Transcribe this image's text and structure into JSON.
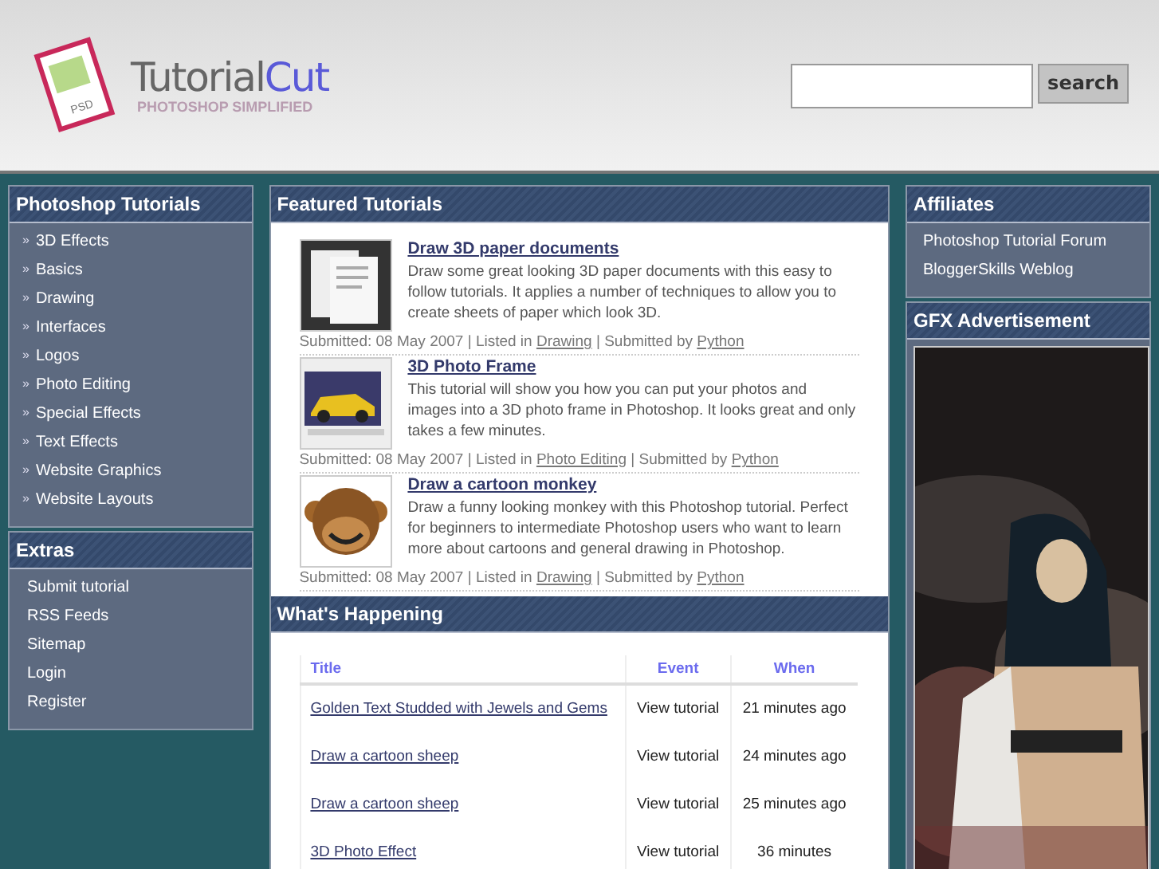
{
  "header": {
    "logo_word_1": "Tutorial",
    "logo_word_2": "Cut",
    "logo_tagline": "PHOTOSHOP SIMPLIFIED",
    "logo_badge": "PSD",
    "search": {
      "button": "search"
    }
  },
  "left": [
    {
      "title": "Photoshop Tutorials",
      "bullet": "»",
      "items": [
        "3D Effects",
        "Basics",
        "Drawing",
        "Interfaces",
        "Logos",
        "Photo Editing",
        "Special Effects",
        "Text Effects",
        "Website Graphics",
        "Website Layouts"
      ]
    },
    {
      "title": "Extras",
      "items": [
        "Submit tutorial",
        "RSS Feeds",
        "Sitemap",
        "Login",
        "Register"
      ]
    }
  ],
  "featured": {
    "title": "Featured Tutorials",
    "items": [
      {
        "kind": "documents",
        "title": "Draw 3D paper documents",
        "description": "Draw some great looking 3D paper documents with this easy to follow tutorials. It applies a number of techniques to allow you to create sheets of paper which look 3D.",
        "submitted": "Submitted: 08 May 2007 | Listed in ",
        "category": "Drawing",
        "by": " | Submitted by ",
        "author": "Python"
      },
      {
        "title": "3D Photo Frame",
        "description": "This tutorial will show you how you can put your photos and images into a 3D photo frame in Photoshop. It looks great and only takes a few minutes.",
        "submitted": "Submitted: 08 May 2007 | Listed in ",
        "category": "Photo Editing",
        "by": " | Submitted by ",
        "author": "Python"
      },
      {
        "kind": "monkey",
        "title": "Draw a cartoon monkey",
        "description": "Draw a funny looking monkey with this Photoshop tutorial. Perfect for beginners to intermediate Photoshop users who want to learn more about cartoons and general drawing in Photoshop.",
        "submitted": "Submitted: 08 May 2007 | Listed in ",
        "category": "Drawing",
        "by": " | Submitted by ",
        "author": "Python"
      }
    ]
  },
  "happening": {
    "title": "What's Happening",
    "columns": [
      "Title",
      "Event",
      "When"
    ],
    "rows": [
      [
        "Golden Text Studded with Jewels and Gems",
        "View tutorial",
        "21 minutes ago"
      ],
      [
        "Draw a cartoon sheep",
        "View tutorial",
        "24 minutes ago"
      ],
      [
        "Draw a cartoon sheep",
        "View tutorial",
        "25 minutes ago"
      ],
      [
        "3D Photo Effect",
        "View tutorial",
        "36 minutes"
      ]
    ]
  },
  "right": [
    {
      "title": "Affiliates",
      "items": [
        "Photoshop Tutorial Forum",
        "BloggerSkills Weblog"
      ]
    },
    {
      "title": "GFX Advertisement",
      "kind": "picture"
    }
  ]
}
